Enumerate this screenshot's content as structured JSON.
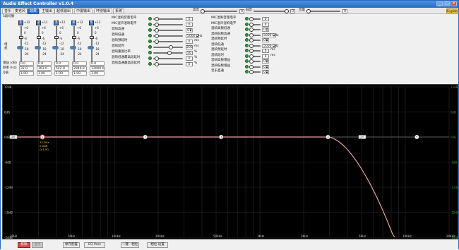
{
  "window": {
    "title": "Audio Effect Controller v1.0.4"
  },
  "tabs": [
    {
      "label": "音乐"
    },
    {
      "label": "麦克风"
    },
    {
      "label": "效果"
    },
    {
      "label": "主输出"
    },
    {
      "label": "超低输出"
    },
    {
      "label": "中置输出"
    },
    {
      "label": "环绕输出"
    },
    {
      "label": "系统"
    }
  ],
  "active_tab": 2,
  "top_sliders": [
    {
      "label": "高音",
      "value": "0"
    },
    {
      "label": "低音",
      "value": "0"
    },
    {
      "label": "音量",
      "value": "0"
    }
  ],
  "language_button": "English",
  "eq": {
    "section_label": "5段均衡",
    "gain_label": "增益",
    "channels": [
      "1",
      "2",
      "3",
      "4",
      "5"
    ],
    "ticks": [
      "+12",
      "+6",
      "0",
      "-6",
      "-12",
      "-18",
      "-24"
    ],
    "rows": [
      {
        "label": "增益 (dB)",
        "values": [
          "0.0",
          "0.0",
          "0.0",
          "0.0",
          "0.0"
        ]
      },
      {
        "label": "频率 (Hz)",
        "values": [
          "32.0",
          "163.0",
          "542.0",
          "2940.0",
          "12000.0"
        ]
      },
      {
        "label": "Q值",
        "values": [
          "1.00",
          "1.00",
          "1.00",
          "1.00",
          "1.00"
        ]
      }
    ],
    "pill_labels": [
      "P",
      "P",
      "P",
      "P",
      "P"
    ]
  },
  "mid_params": [
    {
      "label": "MIC混响音量电平",
      "value": "0"
    },
    {
      "label": "MIC混声混响电平",
      "value": "0"
    },
    {
      "label": "混响高通",
      "value": "Off"
    },
    {
      "label": "混响低通",
      "value": "5000.0Hz"
    },
    {
      "label": "混响预延时",
      "value": "0",
      "unit": "ms"
    },
    {
      "label": "混响延时",
      "value": "200",
      "unit": "ms"
    },
    {
      "label": "混响重复比率",
      "value": "50",
      "unit": "%"
    },
    {
      "label": "混响低通最高段延时",
      "value": "0",
      "unit": "%"
    },
    {
      "label": "混响高通最高段延时",
      "value": "0",
      "unit": "%"
    }
  ],
  "right_params": [
    {
      "label": "MIC混响音量电平",
      "value": "0"
    },
    {
      "label": "MIC混声混响电平",
      "value": "0"
    },
    {
      "label": "混响高频低通",
      "value": "Off"
    },
    {
      "label": "混响低频高通",
      "value": "5000.0Hz"
    },
    {
      "label": "混响预延时",
      "value": "Off"
    },
    {
      "label": "混响低通",
      "value": "5000.0Hz"
    },
    {
      "label": "混响预延时",
      "value": "0",
      "unit": "ms"
    },
    {
      "label": "混响延时",
      "value": "0",
      "unit": "ms"
    },
    {
      "label": "混响高频增益",
      "value": "Off"
    },
    {
      "label": "混响低频增益",
      "value": "Off"
    },
    {
      "label": "音乐直通",
      "value": "Off"
    }
  ],
  "graph": {
    "y_left": [
      "12dB",
      "6dB",
      "0dB",
      "-6dB",
      "-12dB",
      "-18dB",
      "-24dB"
    ],
    "y_right": [
      "12dB",
      "6dB",
      "0dB",
      "-6dB",
      "-12dB",
      "-18dB",
      "-24dB"
    ],
    "x_labels": [
      "20Hz",
      "50Hz",
      "100Hz",
      "200Hz",
      "500Hz",
      "1KHz",
      "2KHz",
      "5KHz",
      "10KHz",
      "20KHz"
    ],
    "points": [
      {
        "tag": "HPF",
        "freq": 20,
        "kind": "label"
      },
      {
        "tag": "1",
        "freq": 32
      },
      {
        "tag": "2",
        "freq": 163
      },
      {
        "tag": "3",
        "freq": 542
      },
      {
        "tag": "4",
        "freq": 2940
      },
      {
        "tag": "LPF",
        "freq": 5000,
        "kind": "label"
      },
      {
        "tag": "5",
        "freq": 12000
      }
    ],
    "selected_info": {
      "line1": "32.0Hz",
      "line2": "0.0dB",
      "line3": "Q:1.00"
    },
    "curve_color": "#e8a0a0",
    "rolloff_start_hz": 2940,
    "rolloff_end_db": -24
  },
  "bottom_buttons": [
    {
      "label": "移除"
    },
    {
      "label": "显示"
    },
    {
      "label": "保存配置"
    },
    {
      "label": "EQ Pass"
    },
    {
      "label": "一键 · 相位"
    },
    {
      "label": "相位 设置"
    }
  ]
}
